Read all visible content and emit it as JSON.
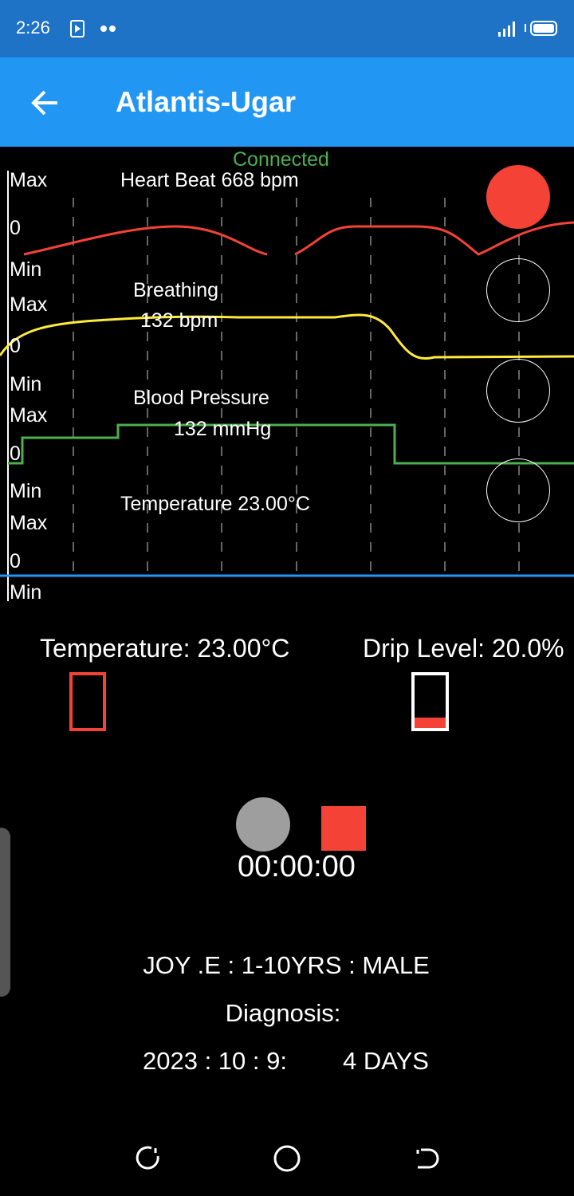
{
  "status_bar": {
    "time": "2:26",
    "colors": {
      "bg": "#1e73c6"
    }
  },
  "app_bar": {
    "title": "Atlantis-Ugar",
    "back_icon": "arrow-left-icon",
    "color": "#2196f3"
  },
  "connection_status": "Connected",
  "axis_labels": {
    "max": "Max",
    "zero": "0",
    "min": "Min"
  },
  "charts": [
    {
      "id": "heart",
      "title": "Heart Beat  668 bpm",
      "color": "#f44336",
      "indicator_filled": true
    },
    {
      "id": "breathing",
      "title": "Breathing",
      "value": "132 bpm",
      "color": "#ffeb3b",
      "indicator_filled": false
    },
    {
      "id": "bp",
      "title": "Blood Pressure",
      "value": "132 mmHg",
      "color": "#4caf50",
      "indicator_filled": false
    },
    {
      "id": "temp",
      "title": "Temperature  23.00°C",
      "color": "#2196f3",
      "indicator_filled": false
    }
  ],
  "readouts": {
    "temperature_label": "Temperature:  23.00°C",
    "drip_label": "Drip Level: 20.0%",
    "drip_level": 0.2,
    "temperature_level": 0.0
  },
  "timer": {
    "value": "00:00:00"
  },
  "patient": {
    "summary": "JOY .E  :  1-10YRS  :  MALE",
    "diagnosis": "Diagnosis:",
    "date_line": "2023 : 10 : 9:",
    "duration": "4 DAYS"
  },
  "nav": {
    "left_icon": "recents-icon",
    "center_icon": "home-icon",
    "right_icon": "back-nav-icon"
  }
}
